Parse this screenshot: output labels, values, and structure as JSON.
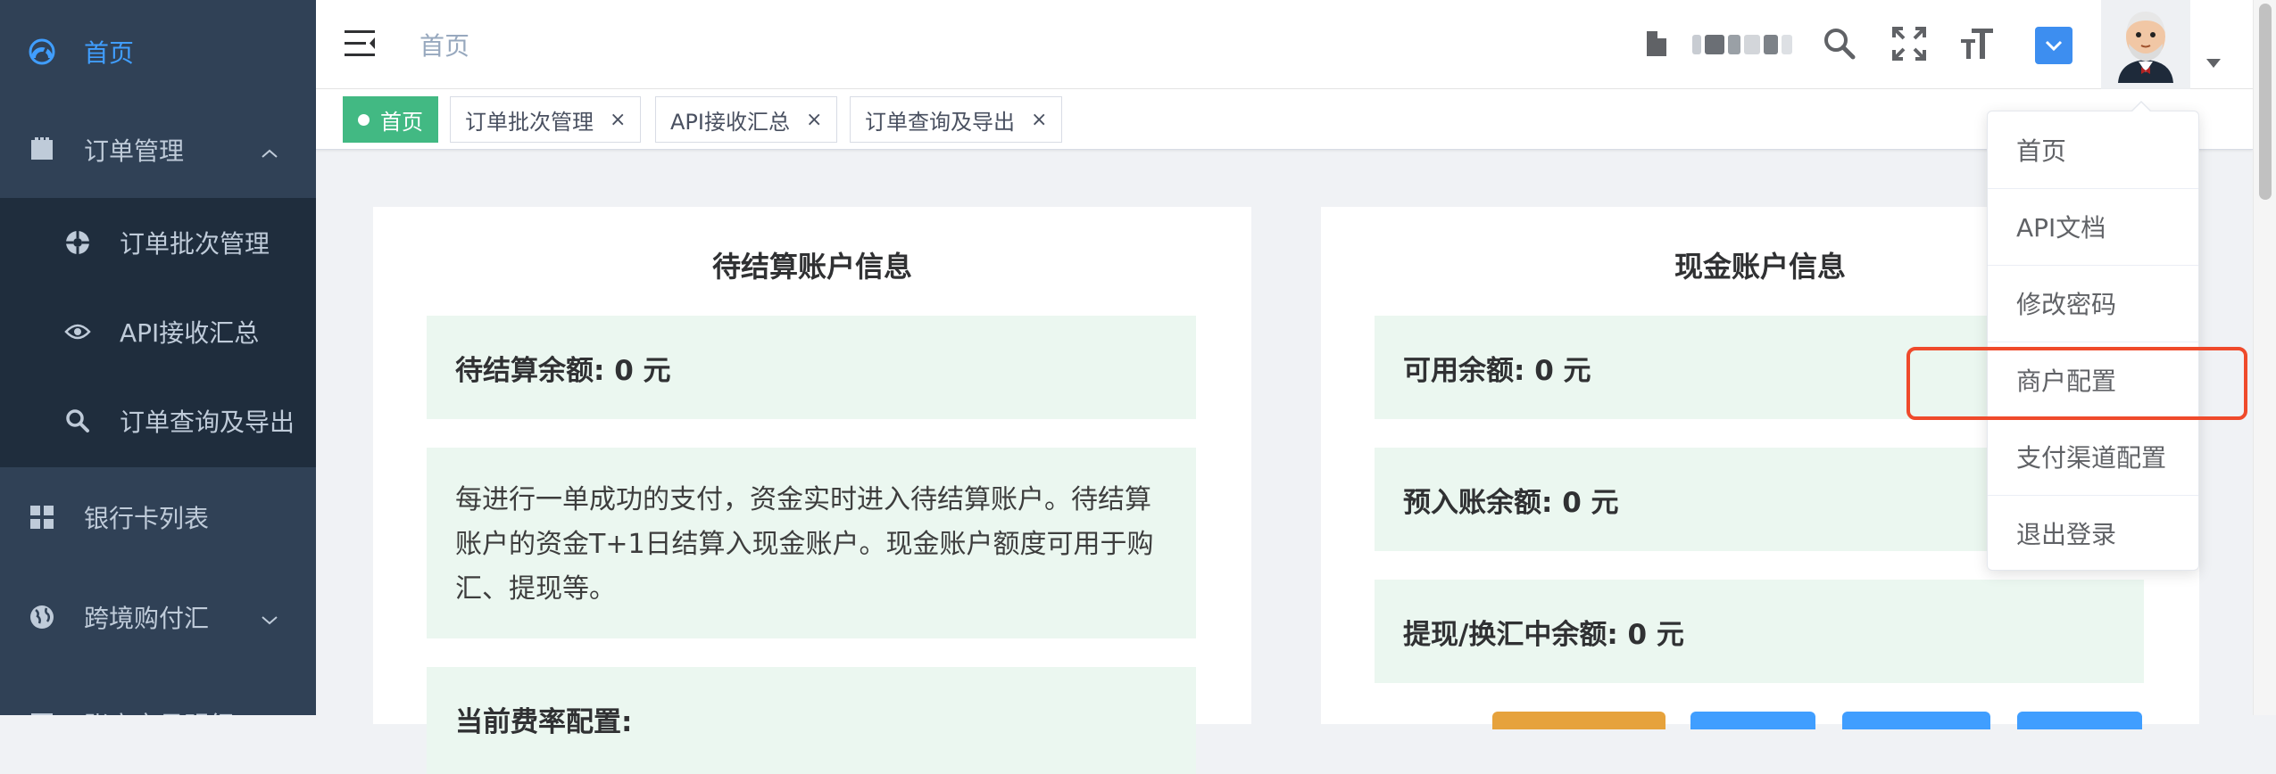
{
  "sidebar": {
    "items": [
      {
        "label": "首页",
        "icon": "dashboard-icon",
        "active": true
      },
      {
        "label": "订单管理",
        "icon": "document-icon",
        "expanded": true
      },
      {
        "label": "银行卡列表",
        "icon": "grid-icon"
      },
      {
        "label": "跨境购付汇",
        "icon": "globe-icon",
        "expandable": true
      },
      {
        "label": "账户交易明细",
        "icon": "list-icon",
        "expandable": true
      }
    ],
    "submenu": [
      {
        "label": "订单批次管理",
        "icon": "aperture-icon"
      },
      {
        "label": "API接收汇总",
        "icon": "eye-icon"
      },
      {
        "label": "订单查询及导出",
        "icon": "search-icon"
      }
    ]
  },
  "navbar": {
    "breadcrumb": "首页",
    "icons": [
      "hamburger-icon",
      "document-icon",
      "search-icon",
      "fullscreen-icon",
      "font-size-icon",
      "dropdown-icon",
      "avatar"
    ]
  },
  "tags": [
    {
      "label": "首页",
      "active": true
    },
    {
      "label": "订单批次管理",
      "closable": true
    },
    {
      "label": "API接收汇总",
      "closable": true
    },
    {
      "label": "订单查询及导出",
      "closable": true
    }
  ],
  "tag_close_glyph": "×",
  "pending_card": {
    "title": "待结算账户信息",
    "balance": "待结算余额: 0 元",
    "description": "每进行一单成功的支付，资金实时进入待结算账户。待结算账户的资金T+1日结算入现金账户。现金账户额度可用于购汇、提现等。",
    "fee_heading": "当前费率配置:"
  },
  "cash_card": {
    "title": "现金账户信息",
    "available": "可用余额: 0 元",
    "pre_entry": "预入账余额: 0 元",
    "withdrawing": "提现/换汇中余额: 0 元"
  },
  "user_dropdown": {
    "items": [
      "首页",
      "API文档",
      "修改密码",
      "商户配置",
      "支付渠道配置",
      "退出登录"
    ],
    "highlighted": "商户配置"
  },
  "colors": {
    "sidebar_bg": "#304156",
    "submenu_bg": "#1f2d3d",
    "active_blue": "#409eff",
    "tag_active_green": "#42b983",
    "info_box_bg": "#ebf7f0",
    "highlight_red": "#ef4a2b"
  }
}
